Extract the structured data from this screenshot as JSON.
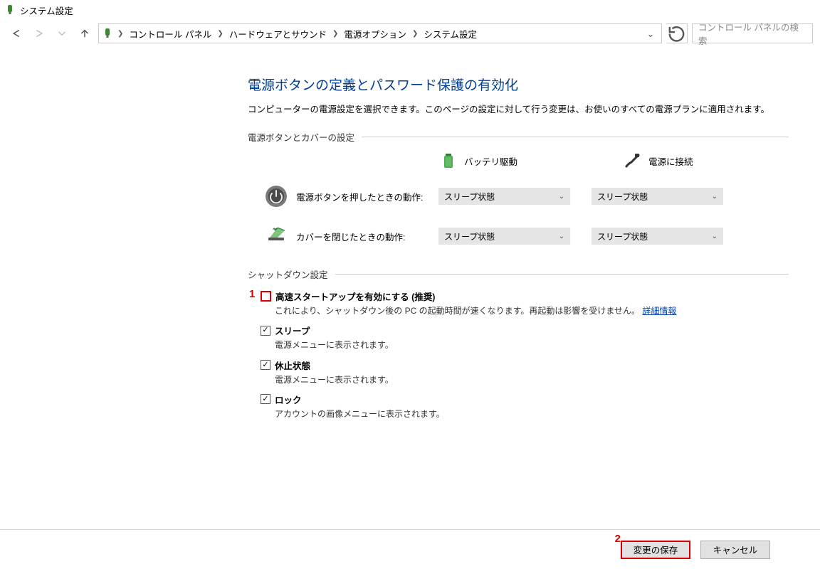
{
  "titlebar": {
    "title": "システム設定"
  },
  "nav": {
    "breadcrumbs": [
      "コントロール パネル",
      "ハードウェアとサウンド",
      "電源オプション",
      "システム設定"
    ],
    "search_placeholder": "コントロール パネルの検索"
  },
  "page": {
    "title": "電源ボタンの定義とパスワード保護の有効化",
    "description": "コンピューターの電源設定を選択できます。このページの設定に対して行う変更は、お使いのすべての電源プランに適用されます。"
  },
  "group_buttons": {
    "header": "電源ボタンとカバーの設定"
  },
  "modes": {
    "battery": "バッテリ駆動",
    "plugged": "電源に接続"
  },
  "settings": {
    "power_button": {
      "label": "電源ボタンを押したときの動作:",
      "battery": "スリープ状態",
      "plugged": "スリープ状態"
    },
    "lid_close": {
      "label": "カバーを閉じたときの動作:",
      "battery": "スリープ状態",
      "plugged": "スリープ状態"
    }
  },
  "group_shutdown": {
    "header": "シャットダウン設定"
  },
  "shutdown": {
    "fast_startup": {
      "label": "高速スタートアップを有効にする (推奨)",
      "desc_pre": "これにより、シャットダウン後の PC の起動時間が速くなります。再起動は影響を受けません。",
      "link": "詳細情報",
      "checked": false
    },
    "sleep": {
      "label": "スリープ",
      "desc": "電源メニューに表示されます。",
      "checked": true
    },
    "hibernate": {
      "label": "休止状態",
      "desc": "電源メニューに表示されます。",
      "checked": true
    },
    "lock": {
      "label": "ロック",
      "desc": "アカウントの画像メニューに表示されます。",
      "checked": true
    }
  },
  "footer": {
    "save": "変更の保存",
    "cancel": "キャンセル"
  },
  "annotations": {
    "a1": "1",
    "a2": "2"
  }
}
